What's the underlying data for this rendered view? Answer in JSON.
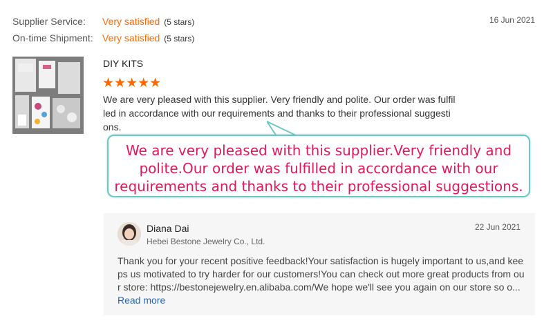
{
  "ratings": [
    {
      "label": "Supplier Service:",
      "value": "Very satisfied",
      "stars_text": "(5 stars)"
    },
    {
      "label": "On-time Shipment:",
      "value": "Very satisfied",
      "stars_text": "(5 stars)"
    }
  ],
  "review": {
    "date": "16 Jun 2021",
    "product_title": "DIY KITS",
    "star_rating": 5,
    "stars": "★★★★★",
    "text": "We are very pleased with this supplier. Very friendly and polite. Our order was fulfilled in accordance with our requirements and thanks to their professional suggestions."
  },
  "callout": {
    "text": "We are very pleased with this supplier.Very friendly and polite.Our order was fulfilled in accordance with our requirements and thanks to their professional suggestions."
  },
  "reply": {
    "name": "Diana Dai",
    "company": "Hebei Bestone Jewelry Co., Ltd.",
    "date": "22 Jun 2021",
    "text": "Thank you for your recent positive feedback!Your satisfaction is hugely important to us,and keeps us motivated to try harder for our customers!You can check out more great products from our store: https://bestonejewelry.en.alibaba.com/We hope we'll see you again on our store so o...",
    "read_more": "Read more"
  },
  "colors": {
    "accent": "#ff6a00",
    "callout_text": "#e0195b",
    "callout_border": "#6cc7c2",
    "link": "#1a66c9"
  }
}
